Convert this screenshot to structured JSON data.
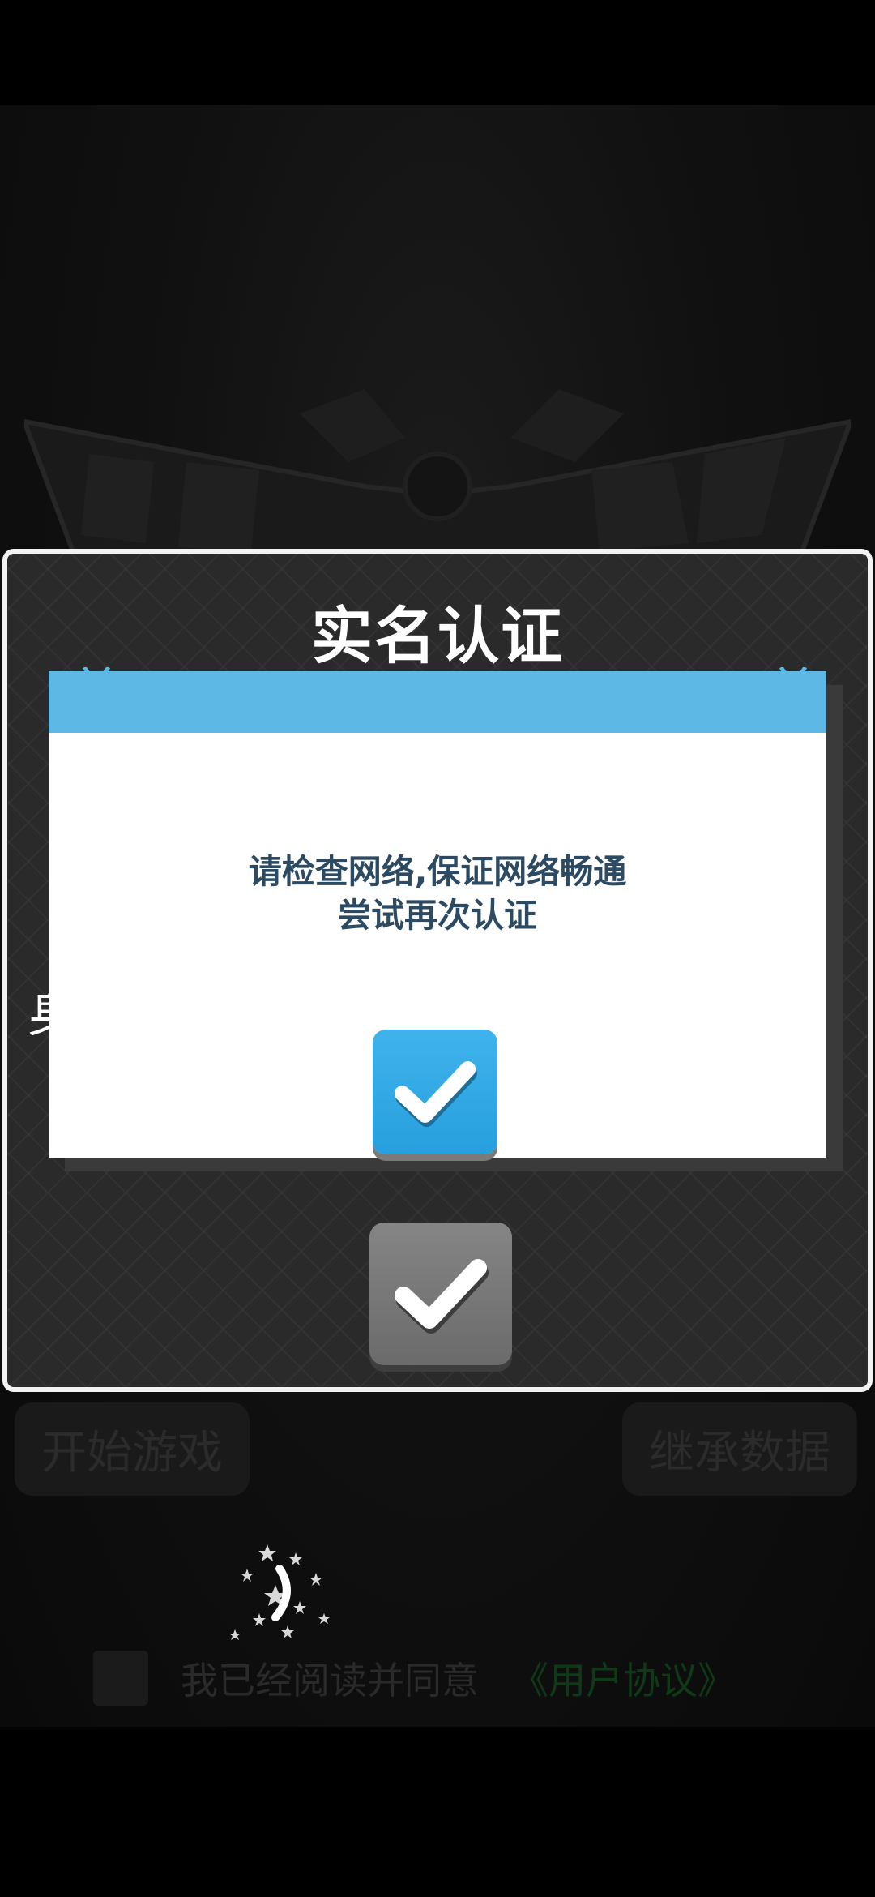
{
  "background": {
    "start_button_label": "开始游戏",
    "inherit_button_label": "继承数据",
    "agree_text": "我已经阅读并同意",
    "agree_link_text": "《用户协议》"
  },
  "dialog": {
    "title": "实名认证",
    "partial_label": "身",
    "confirm_icon": "checkmark-icon"
  },
  "alert": {
    "header_color": "#5db8e6",
    "message_line1": "请检查网络,保证网络畅通",
    "message_line2": "尝试再次认证",
    "confirm_icon": "checkmark-icon",
    "confirm_color": "#3fb3ec"
  }
}
